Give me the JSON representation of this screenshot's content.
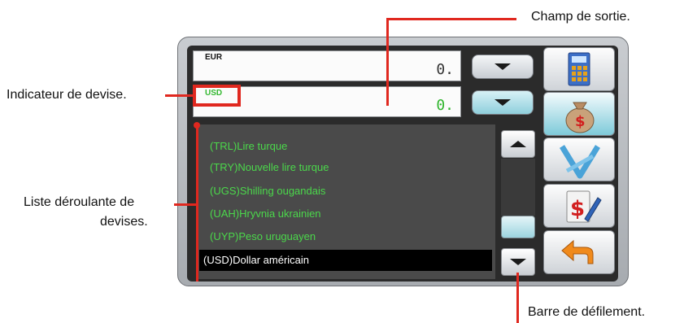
{
  "callouts": {
    "output_field": "Champ de sortie.",
    "currency_indicator": "Indicateur de devise.",
    "currency_list": [
      "Liste déroulante de",
      "devises."
    ],
    "scrollbar": "Barre de défilement."
  },
  "converter": {
    "from": {
      "code": "EUR",
      "value": "0."
    },
    "to": {
      "code": "USD",
      "value": "0."
    }
  },
  "currency_list": {
    "items": [
      "(TRL)Lire turque",
      "(TRY)Nouvelle lire turque",
      "(UGS)Shilling ougandais",
      "(UAH)Hryvnia ukrainien",
      "(UYP)Peso uruguayen"
    ],
    "selected": "(USD)Dollar américain"
  },
  "sidebar": {
    "buttons": [
      "calculator-icon",
      "money-bag-icon",
      "arrows-icon",
      "currency-edit-icon",
      "back-arrow-icon"
    ]
  },
  "colors": {
    "callout_red": "#e0281f",
    "list_text": "#4bd84b",
    "accent_teal": "#8fcfdc"
  }
}
